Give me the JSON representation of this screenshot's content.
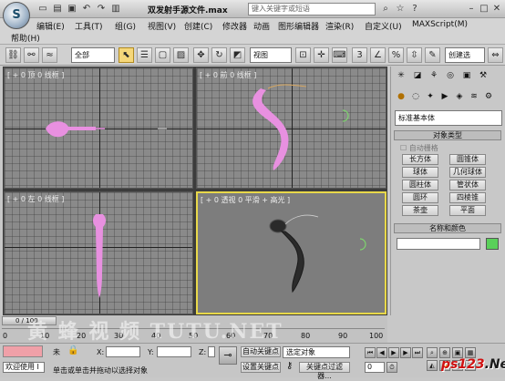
{
  "window": {
    "title": "双发射手源文件.max",
    "search_placeholder": "键入关键字或短语"
  },
  "menu": [
    "编辑(E)",
    "工具(T)",
    "组(G)",
    "视图(V)",
    "创建(C)",
    "修改器",
    "动画",
    "图形编辑器",
    "渲染(R)",
    "自定义(U)",
    "MAXScript(M)",
    "帮助(H)"
  ],
  "toolbar": {
    "selection_filter": "全部",
    "reference_coord": "视图",
    "named_selection": "创建选"
  },
  "viewports": {
    "top_label": "[ + 0 顶 0 线框 ]",
    "front_label": "[ + 0 前 0 线框 ]",
    "left_label": "[ + 0 左 0 线框 ]",
    "persp_label": "[ + 0 透视 0 平滑 + 高光 ]"
  },
  "command_panel": {
    "category": "标准基本体",
    "object_type_header": "对象类型",
    "autogrid_label": "自动栅格",
    "objects": [
      "长方体",
      "圆锥体",
      "球体",
      "几何球体",
      "圆柱体",
      "管状体",
      "圆环",
      "四棱锥",
      "茶壶",
      "平面"
    ],
    "name_color_header": "名称和颜色",
    "swatch_color": "#5ad05a"
  },
  "timeline": {
    "frame_counter": "0 / 100",
    "ticks": [
      "0",
      "10",
      "20",
      "30",
      "40",
      "50",
      "60",
      "70",
      "80",
      "90",
      "100"
    ]
  },
  "status": {
    "listener_label": "欢迎使用 I",
    "unlock_label": "未",
    "x_label": "X:",
    "y_label": "Y:",
    "z_label": "Z:",
    "prompt_text": "单击或单击并拖动以选择对象",
    "auto_key": "自动关键点",
    "set_key": "设置关键点",
    "key_filter": "关键点过滤器...",
    "selected_object": "选定对象",
    "frame_field": "0"
  },
  "watermarks": {
    "site": "TUTU.NET",
    "brand_left": "ps123",
    "brand_right": ".Net"
  },
  "colors": {
    "object_pink": "#e890e0",
    "active_viewport_border": "#e8d84a"
  }
}
